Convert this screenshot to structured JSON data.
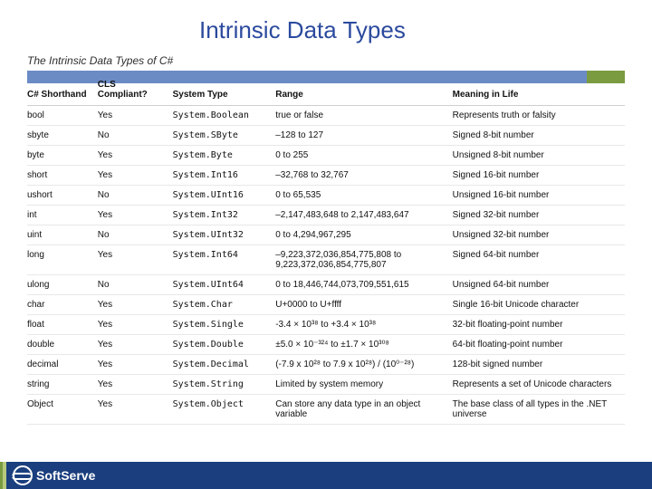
{
  "title": "Intrinsic Data Types",
  "caption": "The Intrinsic Data Types of C#",
  "columns": [
    "C# Shorthand",
    "CLS Compliant?",
    "System Type",
    "Range",
    "Meaning in Life"
  ],
  "chart_data": {
    "type": "table",
    "title": "The Intrinsic Data Types of C#",
    "columns": [
      "C# Shorthand",
      "CLS Compliant?",
      "System Type",
      "Range",
      "Meaning in Life"
    ],
    "rows": [
      {
        "shorthand": "bool",
        "cls": "Yes",
        "system": "System.Boolean",
        "range": "true or false",
        "meaning": "Represents truth or falsity"
      },
      {
        "shorthand": "sbyte",
        "cls": "No",
        "system": "System.SByte",
        "range": "–128 to 127",
        "meaning": "Signed 8-bit number"
      },
      {
        "shorthand": "byte",
        "cls": "Yes",
        "system": "System.Byte",
        "range": "0 to 255",
        "meaning": "Unsigned 8-bit number"
      },
      {
        "shorthand": "short",
        "cls": "Yes",
        "system": "System.Int16",
        "range": "–32,768 to 32,767",
        "meaning": "Signed 16-bit number"
      },
      {
        "shorthand": "ushort",
        "cls": "No",
        "system": "System.UInt16",
        "range": "0 to 65,535",
        "meaning": "Unsigned 16-bit number"
      },
      {
        "shorthand": "int",
        "cls": "Yes",
        "system": "System.Int32",
        "range": "–2,147,483,648 to 2,147,483,647",
        "meaning": "Signed 32-bit number"
      },
      {
        "shorthand": "uint",
        "cls": "No",
        "system": "System.UInt32",
        "range": "0 to 4,294,967,295",
        "meaning": "Unsigned 32-bit number"
      },
      {
        "shorthand": "long",
        "cls": "Yes",
        "system": "System.Int64",
        "range": "–9,223,372,036,854,775,808 to 9,223,372,036,854,775,807",
        "meaning": "Signed 64-bit number"
      },
      {
        "shorthand": "ulong",
        "cls": "No",
        "system": "System.UInt64",
        "range": "0 to 18,446,744,073,709,551,615",
        "meaning": "Unsigned 64-bit number"
      },
      {
        "shorthand": "char",
        "cls": "Yes",
        "system": "System.Char",
        "range": "U+0000 to U+ffff",
        "meaning": "Single 16-bit Unicode character"
      },
      {
        "shorthand": "float",
        "cls": "Yes",
        "system": "System.Single",
        "range": "-3.4 × 10³⁸ to +3.4 × 10³⁸",
        "meaning": "32-bit floating-point number"
      },
      {
        "shorthand": "double",
        "cls": "Yes",
        "system": "System.Double",
        "range": "±5.0 × 10⁻³²⁴ to ±1.7 × 10³⁰⁸",
        "meaning": "64-bit floating-point number"
      },
      {
        "shorthand": "decimal",
        "cls": "Yes",
        "system": "System.Decimal",
        "range": "(-7.9 x 10²⁸ to 7.9 x 10²⁸) / (10⁰⁻²⁸)",
        "meaning": "128-bit signed number"
      },
      {
        "shorthand": "string",
        "cls": "Yes",
        "system": "System.String",
        "range": "Limited by system memory",
        "meaning": "Represents a set of Unicode  characters"
      },
      {
        "shorthand": "Object",
        "cls": "Yes",
        "system": "System.Object",
        "range": "Can store any data type in an object variable",
        "meaning": "The base class of all types in the .NET universe"
      }
    ]
  },
  "brand": "SoftServe"
}
